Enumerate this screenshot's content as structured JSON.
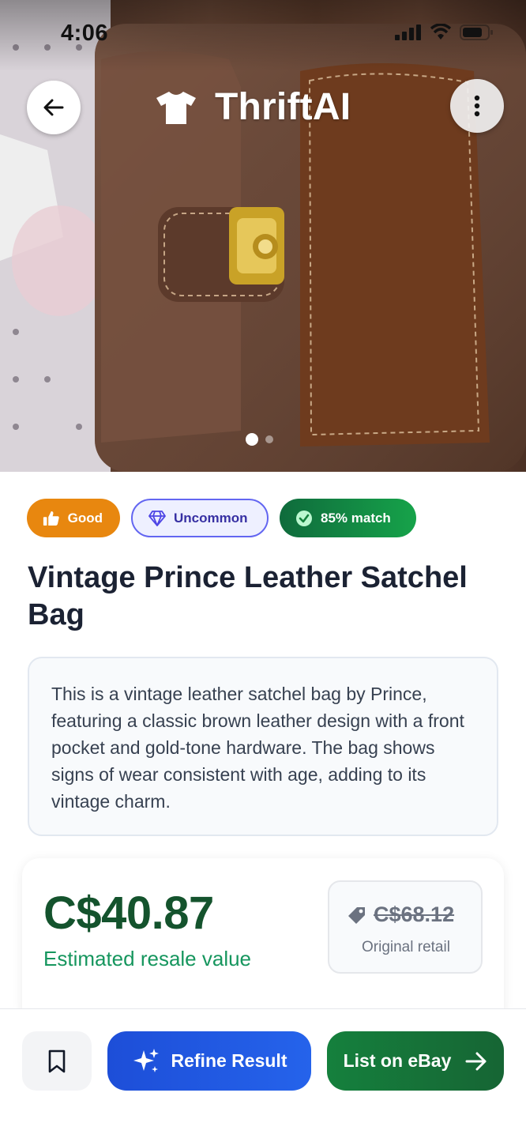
{
  "status_bar": {
    "time": "4:06"
  },
  "header": {
    "app_name": "ThriftAI",
    "back_icon": "arrow-left-icon",
    "logo_icon": "tshirt-icon",
    "menu_icon": "more-vertical-icon"
  },
  "gallery": {
    "image_count": 2,
    "active_index": 0
  },
  "badges": {
    "condition": {
      "label": "Good",
      "icon": "thumbs-up-icon",
      "color": "#e8870f"
    },
    "rarity": {
      "label": "Uncommon",
      "icon": "diamond-icon",
      "color": "#6366f1"
    },
    "match": {
      "label": "85% match",
      "icon": "check-circle-icon",
      "color": "#16a34a"
    }
  },
  "item": {
    "title": "Vintage Prince Leather Satchel Bag",
    "description": "This is a vintage leather satchel bag by Prince, featuring a classic brown leather design with a front pocket and gold-tone hardware. The bag shows signs of wear consistent with age, adding to its vintage charm."
  },
  "pricing": {
    "estimated_value": "C$40.87",
    "estimated_caption": "Estimated resale value",
    "original_retail": "C$68.12",
    "original_caption": "Original retail"
  },
  "actions": {
    "bookmark_icon": "bookmark-icon",
    "refine_label": "Refine Result",
    "refine_icon": "sparkles-icon",
    "ebay_label": "List on eBay",
    "ebay_icon": "arrow-right-icon"
  },
  "colors": {
    "price_green": "#14532d",
    "refine_blue": "#1d4ed8",
    "ebay_green": "#15803d"
  }
}
